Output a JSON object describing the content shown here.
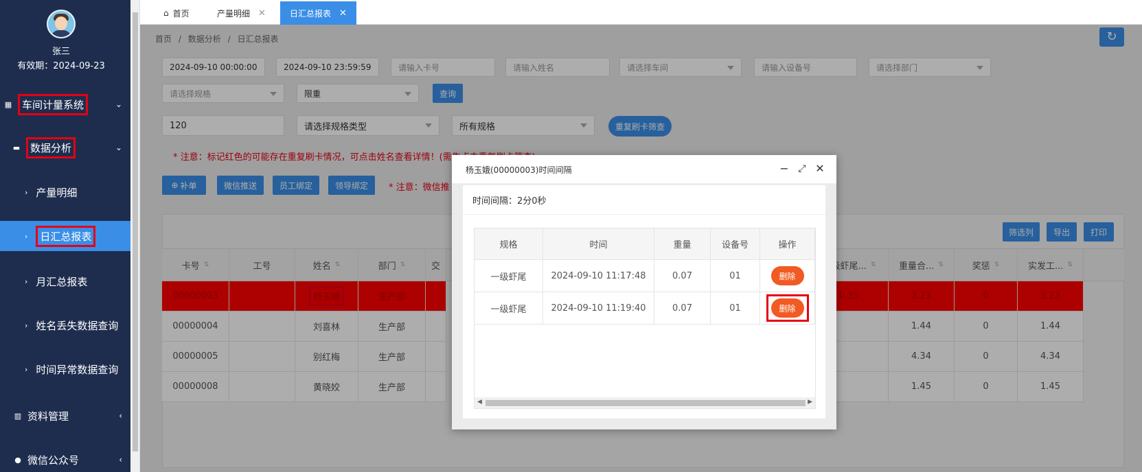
{
  "user": {
    "name": "张三",
    "expire": "有效期：2024-09-23"
  },
  "sidebar": {
    "groups": [
      {
        "label": "车间计量系统",
        "icon": "dashboard-icon",
        "arrow": "⌄"
      },
      {
        "label": "数据分析",
        "icon": "monitor-icon",
        "arrow": "⌄"
      },
      {
        "label": "资料管理",
        "icon": "book-icon",
        "arrow": "‹"
      },
      {
        "label": "微信公众号",
        "icon": "wechat-icon",
        "arrow": "‹"
      }
    ],
    "subitems": [
      {
        "label": "产量明细"
      },
      {
        "label": "日汇总报表"
      },
      {
        "label": "月汇总报表"
      },
      {
        "label": "姓名丢失数据查询"
      },
      {
        "label": "时间异常数据查询"
      }
    ]
  },
  "tabs": [
    {
      "label": "首页",
      "icon": "home-icon"
    },
    {
      "label": "产量明细",
      "close": "✕"
    },
    {
      "label": "日汇总报表",
      "close": "✕"
    }
  ],
  "breadcrumb": [
    "首页",
    "/",
    "数据分析",
    "/",
    "日汇总报表"
  ],
  "filters": {
    "start_time": "2024-09-10 00:00:00",
    "end_time": "2024-09-10 23:59:59",
    "card_placeholder": "请输入卡号",
    "name_placeholder": "请输入姓名",
    "workshop_placeholder": "请选择车间",
    "device_placeholder": "请输入设备号",
    "dept_placeholder": "请选择部门",
    "spec_placeholder": "请选择规格",
    "weight_select": "限重",
    "query_label": "查询",
    "seconds_value": "120",
    "spec_type_select": "请选择规格类型",
    "all_spec_select": "所有规格",
    "dup_filter_label": "重复刷卡筛查"
  },
  "notice1": "* 注意：标记红色的可能存在重复刷卡情况，可点击姓名查看详情！(需先点击重复刷卡筛查)",
  "notice2": "* 注意：微信推",
  "toolbar": {
    "add_label": "补单",
    "wechat_push": "微信推送",
    "employee_bind": "员工绑定",
    "leader_bind": "领导绑定"
  },
  "table_tools": {
    "filter_cols": "筛选列",
    "export": "导出",
    "print": "打印"
  },
  "table": {
    "left_columns": [
      "卡号",
      "工号",
      "姓名",
      "部门",
      "交"
    ],
    "right_columns": [
      "一级虾尾...",
      "重量合...",
      "奖惩",
      "实发工..."
    ],
    "rows": [
      {
        "card": "00000003",
        "job": "",
        "name": "杨玉娥",
        "dept": "生产部",
        "r1": "0.35",
        "r2": "3.23",
        "r3": "0",
        "r4": "3.23",
        "red": true
      },
      {
        "card": "00000004",
        "job": "",
        "name": "刘喜林",
        "dept": "生产部",
        "r1": "",
        "r2": "1.44",
        "r3": "0",
        "r4": "1.44",
        "red": false
      },
      {
        "card": "00000005",
        "job": "",
        "name": "别红梅",
        "dept": "生产部",
        "r1": "",
        "r2": "4.34",
        "r3": "0",
        "r4": "4.34",
        "red": false
      },
      {
        "card": "00000008",
        "job": "",
        "name": "黄晓姣",
        "dept": "生产部",
        "r1": "",
        "r2": "1.45",
        "r3": "0",
        "r4": "1.45",
        "red": false
      }
    ]
  },
  "modal": {
    "title": "杨玉娥(00000003)时间间隔",
    "interval": "时间间隔：2分0秒",
    "columns": [
      "规格",
      "时间",
      "重量",
      "设备号",
      "操作"
    ],
    "rows": [
      {
        "spec": "一级虾尾",
        "time": "2024-09-10 11:17:48",
        "weight": "0.07",
        "device": "01",
        "action": "删除"
      },
      {
        "spec": "一级虾尾",
        "time": "2024-09-10 11:19:40",
        "weight": "0.07",
        "device": "01",
        "action": "删除"
      }
    ]
  },
  "colors": {
    "sidebar": "#1e2d4e",
    "accent": "#3a8ee6",
    "highlight_red": "#ff0000",
    "delete_orange": "#f15a22"
  }
}
